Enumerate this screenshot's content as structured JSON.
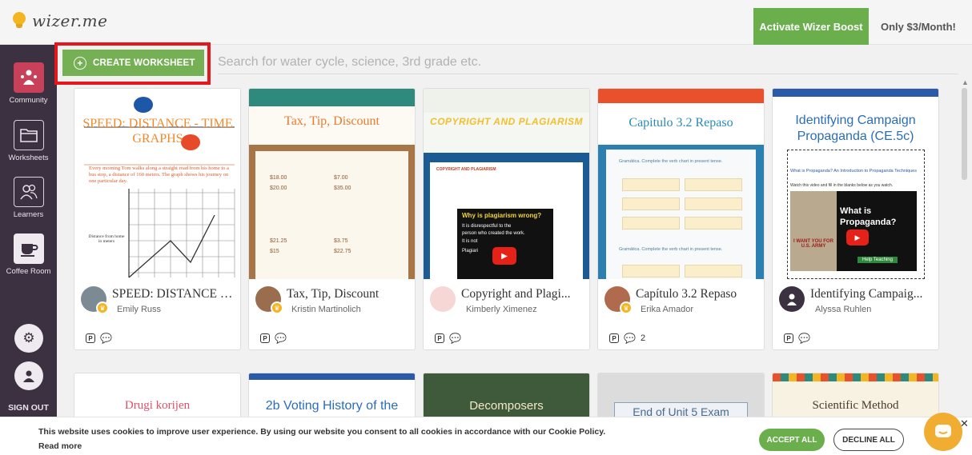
{
  "header": {
    "logo_text": "wizer.me",
    "boost_label": "Activate Wizer Boost",
    "boost_price": "Only $3/Month!"
  },
  "sidebar": {
    "items": [
      {
        "label": "Community",
        "icon": "community-icon"
      },
      {
        "label": "Worksheets",
        "icon": "folder-icon"
      },
      {
        "label": "Learners",
        "icon": "learners-icon"
      },
      {
        "label": "Coffee Room",
        "icon": "coffee-icon"
      }
    ],
    "settings_icon": "gear-icon",
    "profile_icon": "user-icon",
    "signout_label": "SIGN OUT"
  },
  "toolbar": {
    "create_label": "CREATE WORKSHEET",
    "search_placeholder": "Search for water cycle, science, 3rd grade etc."
  },
  "cards": [
    {
      "title": "SPEED: DISTANCE - ...",
      "author": "Emily Russ",
      "comments": "",
      "thumb_title": "SPEED: DISTANCE - TIME GRAPHS",
      "thumb_text": "Every morning Tom walks along a straight road from his home to a bus stop, a distance of 160 meters. The graph shows his journey on one particular day.",
      "thumb_axis": "Distance from home in meters"
    },
    {
      "title": "Tax, Tip, Discount",
      "author": "Kristin Martinolich",
      "comments": "",
      "thumb_title": "Tax, Tip, Discount",
      "thumb_opts": [
        "$18.00",
        "$7.00",
        "$20.00",
        "$35.00",
        "$21.25",
        "$3.75",
        "$15",
        "$22.75"
      ]
    },
    {
      "title": "Copyright and Plagi...",
      "author": "Kimberly Ximenez",
      "comments": "",
      "thumb_title": "COPYRIGHT AND PLAGIARISM",
      "thumb_video": "Why is plagiarism wrong?",
      "thumb_lines": [
        "It is disrespectful to the person who created the work.",
        "It is not",
        "Plagiari"
      ],
      "thumb_small": "COPYRIGHT AND PLAGIARISM"
    },
    {
      "title": "Capítulo 3.2 Repaso",
      "author": "Erika Amador",
      "comments": "2",
      "thumb_title": "Capitulo 3.2 Repaso",
      "thumb_line1": "Gramática. Complete the verb chart in present tense.",
      "thumb_line2": "Gramática. Complete the verb chart in present tense."
    },
    {
      "title": "Identifying Campaig...",
      "author": "Alyssa Ruhlen",
      "comments": "",
      "thumb_title": "Identifying Campaign Propaganda (CE.5c)",
      "thumb_link": "What is Propaganda? An Introduction to Propaganda Techniques",
      "thumb_note": "Watch this video and fill in the blanks below as you watch.",
      "thumb_video": "What is Propaganda?",
      "thumb_poster": "I WANT YOU FOR U.S. ARMY",
      "thumb_help": "Help Teaching"
    }
  ],
  "cards_row2": [
    {
      "title": "Drugi korijen"
    },
    {
      "title": "2b Voting History of the"
    },
    {
      "title": "Decomposers"
    },
    {
      "title": "End of Unit 5 Exam"
    },
    {
      "title": "Scientific Method"
    }
  ],
  "cookie": {
    "text": "This website uses cookies to improve user experience. By using our website you consent to all cookies in accordance with our Cookie Policy.",
    "read_more": "Read more",
    "accept": "ACCEPT ALL",
    "decline": "DECLINE ALL"
  },
  "colors": {
    "accent_green": "#6aaf4c",
    "sidebar": "#3c3140",
    "highlight": "#e5161c"
  }
}
